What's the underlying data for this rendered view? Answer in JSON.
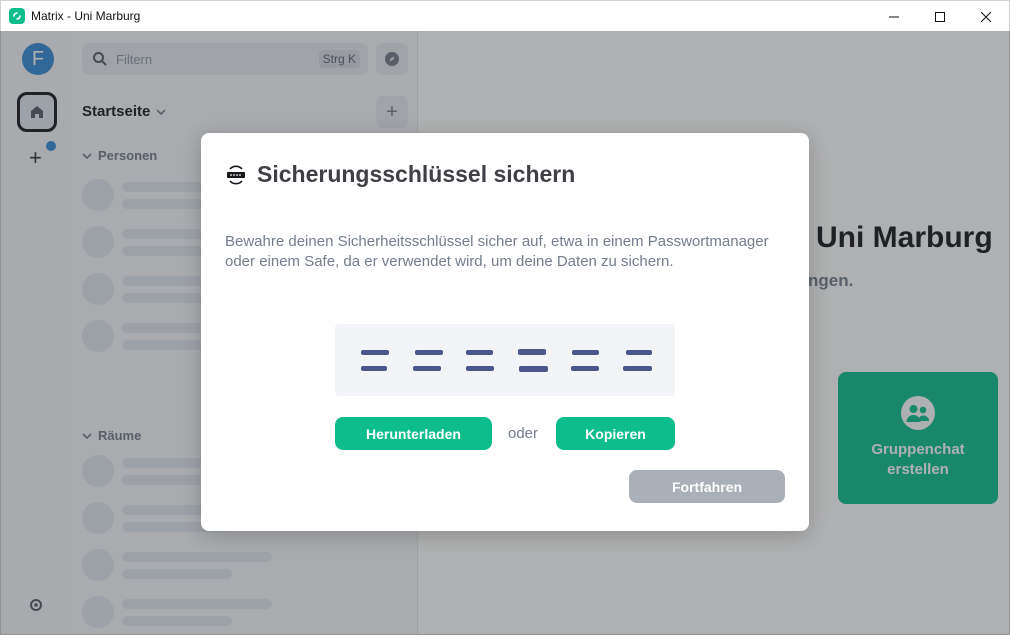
{
  "window": {
    "title": "Matrix - Uni Marburg",
    "controls": [
      "minimize-icon",
      "maximize-icon",
      "close-icon"
    ]
  },
  "spaces": {
    "avatar_letter": "F",
    "icons": [
      "home-icon",
      "plus-icon",
      "settings-icon"
    ]
  },
  "roomlist": {
    "filter_placeholder": "Filtern",
    "filter_shortcut": "Strg K",
    "home_title": "Startseite",
    "sections": [
      "Personen",
      "Räume"
    ]
  },
  "main": {
    "welcome_title": "Uni Marburg",
    "welcome_subtitle": "ngen.",
    "group_chat_label_line1": "Gruppenchat",
    "group_chat_label_line2": "erstellen"
  },
  "dialog": {
    "title": "Sicherungsschlüssel sichern",
    "description": "Bewahre deinen Sicherheitsschlüssel sicher auf, etwa in einem Passwortmanager oder einem Safe, da er verwendet wird, um deine Daten zu sichern.",
    "download_label": "Herunterladen",
    "or_label": "oder",
    "copy_label": "Kopieren",
    "continue_label": "Fortfahren"
  },
  "colors": {
    "accent": "#0dbd8b",
    "avatar": "#368bd6",
    "disabled_button": "#a9b0b8",
    "muted_text": "#737d8c"
  }
}
